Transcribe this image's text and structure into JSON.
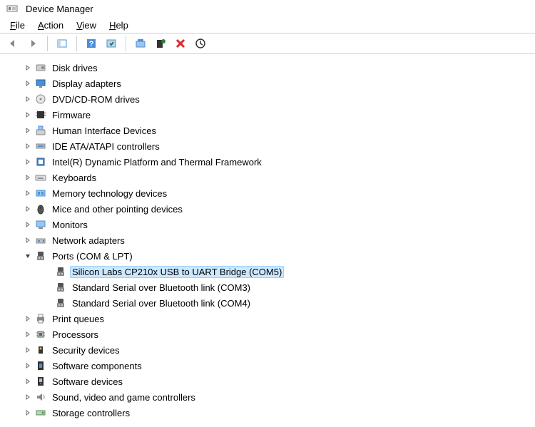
{
  "window": {
    "title": "Device Manager"
  },
  "menu": {
    "file": "File",
    "action": "Action",
    "view": "View",
    "help": "Help"
  },
  "tree": [
    {
      "icon": "disk",
      "label": "Disk drives",
      "exp": "collapsed"
    },
    {
      "icon": "display",
      "label": "Display adapters",
      "exp": "collapsed"
    },
    {
      "icon": "dvd",
      "label": "DVD/CD-ROM drives",
      "exp": "collapsed"
    },
    {
      "icon": "firmware",
      "label": "Firmware",
      "exp": "collapsed"
    },
    {
      "icon": "hid",
      "label": "Human Interface Devices",
      "exp": "collapsed"
    },
    {
      "icon": "ide",
      "label": "IDE ATA/ATAPI controllers",
      "exp": "collapsed"
    },
    {
      "icon": "intel",
      "label": "Intel(R) Dynamic Platform and Thermal Framework",
      "exp": "collapsed"
    },
    {
      "icon": "keyboard",
      "label": "Keyboards",
      "exp": "collapsed"
    },
    {
      "icon": "memory",
      "label": "Memory technology devices",
      "exp": "collapsed"
    },
    {
      "icon": "mouse",
      "label": "Mice and other pointing devices",
      "exp": "collapsed"
    },
    {
      "icon": "monitor",
      "label": "Monitors",
      "exp": "collapsed"
    },
    {
      "icon": "network",
      "label": "Network adapters",
      "exp": "collapsed"
    },
    {
      "icon": "port-cat",
      "label": "Ports (COM & LPT)",
      "exp": "expanded",
      "children": [
        {
          "icon": "port",
          "label": "Silicon Labs CP210x USB to UART Bridge (COM5)",
          "selected": true
        },
        {
          "icon": "port",
          "label": "Standard Serial over Bluetooth link (COM3)"
        },
        {
          "icon": "port",
          "label": "Standard Serial over Bluetooth link (COM4)"
        }
      ]
    },
    {
      "icon": "printer",
      "label": "Print queues",
      "exp": "collapsed"
    },
    {
      "icon": "cpu",
      "label": "Processors",
      "exp": "collapsed"
    },
    {
      "icon": "security",
      "label": "Security devices",
      "exp": "collapsed"
    },
    {
      "icon": "swcomp",
      "label": "Software components",
      "exp": "collapsed"
    },
    {
      "icon": "swdev",
      "label": "Software devices",
      "exp": "collapsed"
    },
    {
      "icon": "sound",
      "label": "Sound, video and game controllers",
      "exp": "collapsed"
    },
    {
      "icon": "storage",
      "label": "Storage controllers",
      "exp": "collapsed"
    }
  ]
}
